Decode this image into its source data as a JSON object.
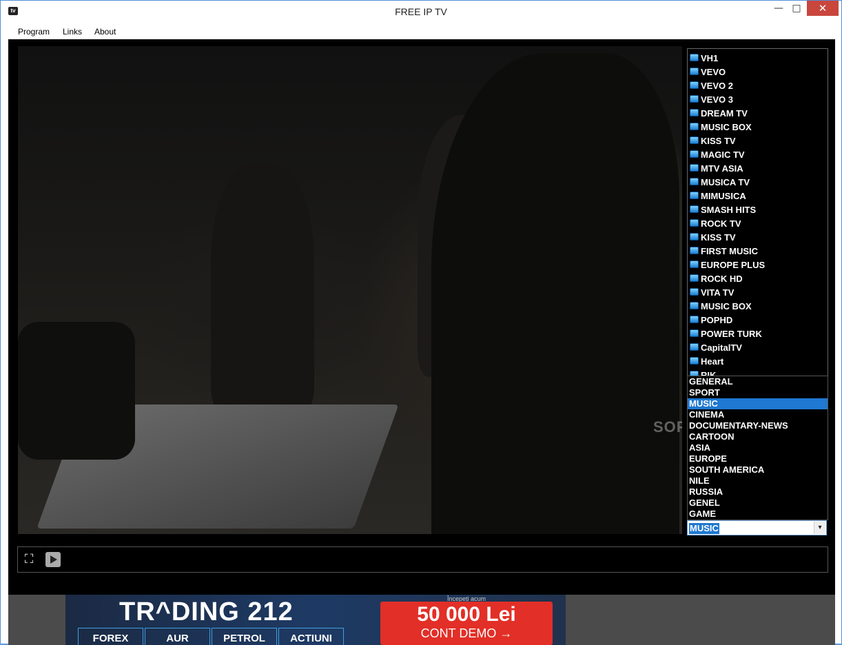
{
  "window": {
    "title": "FREE IP TV",
    "icon_text": "tv",
    "minimize_glyph": "—",
    "maximize_glyph": "□",
    "close_glyph": "✕"
  },
  "menu": [
    "Program",
    "Links",
    "About"
  ],
  "channels": [
    "VH1",
    "VEVO",
    "VEVO 2",
    "VEVO 3",
    "DREAM TV",
    "MUSIC BOX",
    "KISS TV",
    "MAGIC TV",
    "MTV ASIA",
    "MUSICA TV",
    "MIMUSICA",
    "SMASH HITS",
    "ROCK TV",
    "KISS TV",
    "FIRST MUSIC",
    "EUROPE PLUS",
    "ROCK HD",
    "VITA TV",
    "MUSIC BOX",
    "POPHD",
    "POWER TURK",
    "CapitalTV",
    "Heart",
    "RIK"
  ],
  "categories": [
    "GENERAL",
    "SPORT",
    "MUSIC",
    "CINEMA",
    "DOCUMENTARY-NEWS",
    "CARTOON",
    "ASIA",
    "EUROPE",
    "SOUTH AMERICA",
    "NILE",
    "RUSSIA",
    "GENEL",
    "GAME"
  ],
  "selected_category": "MUSIC",
  "combo": {
    "value": "MUSIC",
    "arrow_glyph": "▾"
  },
  "watermark": "SOFTPEDIA",
  "controls": {
    "fullscreen_glyph": "⛶"
  },
  "ad": {
    "tagline": "Începeți acum",
    "brand": "TR^DING 212",
    "tabs": [
      "FOREX",
      "AUR",
      "PETROL",
      "ACTIUNI"
    ],
    "amount": "50 000 Lei",
    "cta": "CONT DEMO →"
  },
  "colors": {
    "selection": "#1f78d1",
    "close_button": "#c9463d",
    "ad_cta": "#e22f27"
  }
}
